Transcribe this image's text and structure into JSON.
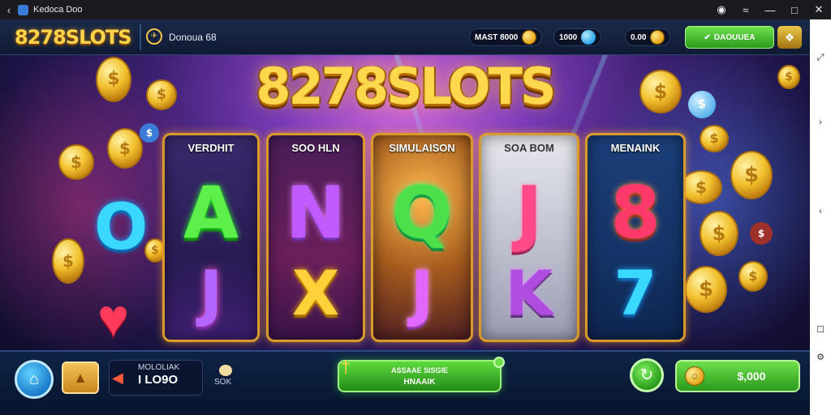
{
  "window": {
    "title": "Kedoca Doo",
    "back_icon": "back-arrow-icon",
    "controls": [
      "github-icon",
      "wifi-icon",
      "minimize-icon",
      "maximize-icon",
      "close-icon"
    ]
  },
  "top_hud": {
    "logo": "8278SLOTS",
    "location_label": "Donoua 68",
    "pills": [
      {
        "label": "MAST 8000",
        "icon": "coin-icon"
      },
      {
        "label": "1000",
        "icon": "gem-icon"
      },
      {
        "label": "0.00",
        "icon": "coin-icon"
      }
    ],
    "green_button": "DAOUUEA",
    "gift_icon": "gift-icon"
  },
  "main_logo": "8278SLOTS",
  "reels": [
    {
      "label": "VERDHIT",
      "symbol_top": "A",
      "symbol_bottom": "J"
    },
    {
      "label": "SOO HLN",
      "symbol_top": "N",
      "symbol_bottom": "X"
    },
    {
      "label": "SIMULAISON",
      "symbol_top": "Q",
      "symbol_bottom": "J"
    },
    {
      "label": "SOA BOM",
      "symbol_top": "J",
      "symbol_bottom": "K"
    },
    {
      "label": "MENAINK",
      "symbol_top": "8",
      "symbol_bottom": "7"
    }
  ],
  "bottom_hud": {
    "balance_label": "MOLOLIAK",
    "balance_value": "I LO9O",
    "chip_label": "SOK",
    "spin_line1": "ASSAAE SISGIE",
    "spin_line2": "HNAAIK",
    "buy_amount": "$,000"
  },
  "colors": {
    "accent_gold": "#ffd84d",
    "accent_green": "#2b9a1d",
    "accent_blue": "#3ad8ff"
  }
}
